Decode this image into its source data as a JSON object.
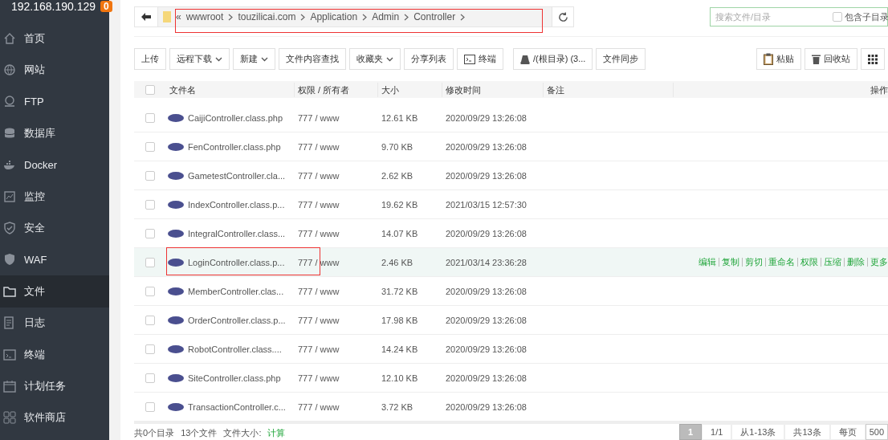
{
  "sidebar": {
    "host": "192.168.190.129",
    "badge": "0",
    "items": [
      {
        "label": "首页",
        "selected": false
      },
      {
        "label": "网站",
        "selected": false
      },
      {
        "label": "FTP",
        "selected": false
      },
      {
        "label": "数据库",
        "selected": false
      },
      {
        "label": "Docker",
        "selected": false
      },
      {
        "label": "监控",
        "selected": false
      },
      {
        "label": "安全",
        "selected": false
      },
      {
        "label": "WAF",
        "selected": false
      },
      {
        "label": "文件",
        "selected": true
      },
      {
        "label": "日志",
        "selected": false
      },
      {
        "label": "终端",
        "selected": false
      },
      {
        "label": "计划任务",
        "selected": false
      },
      {
        "label": "软件商店",
        "selected": false
      }
    ]
  },
  "path": {
    "annotated": true,
    "root_mark": "«",
    "segments": [
      "wwwroot",
      "touzilicai.com",
      "Application",
      "Admin",
      "Controller"
    ]
  },
  "search": {
    "placeholder": "搜索文件/目录",
    "include_sub": {
      "label": "包含子目录",
      "checked": false
    }
  },
  "toolbar": {
    "left": [
      {
        "label": "上传",
        "kind": "plain"
      },
      {
        "label": "远程下载",
        "kind": "dropdown"
      },
      {
        "label": "新建",
        "kind": "dropdown"
      },
      {
        "label": "文件内容查找",
        "kind": "plain"
      },
      {
        "label": "收藏夹",
        "kind": "dropdown"
      },
      {
        "label": "分享列表",
        "kind": "plain"
      },
      {
        "label": "终端",
        "kind": "terminal"
      },
      {
        "label": "/(根目录) (3...",
        "kind": "disk"
      },
      {
        "label": "文件同步",
        "kind": "plain"
      }
    ],
    "right": [
      {
        "label": "粘贴",
        "kind": "paste"
      },
      {
        "label": "回收站",
        "kind": "trash"
      },
      {
        "kind": "grid"
      }
    ]
  },
  "table": {
    "select_all": {
      "checked": false
    },
    "columns": [
      "文件名",
      "权限 / 所有者",
      "大小",
      "修改时间",
      "备注",
      "操作"
    ],
    "rows": [
      {
        "name": "CaijiController.class.php",
        "perm": "777 / www",
        "size": "12.61 KB",
        "mtime": "2020/09/29 13:26:08",
        "checked": false,
        "highlighted": false,
        "annotated": false
      },
      {
        "name": "FenController.class.php",
        "perm": "777 / www",
        "size": "9.70 KB",
        "mtime": "2020/09/29 13:26:08",
        "checked": false,
        "highlighted": false,
        "annotated": false
      },
      {
        "name": "GametestController.cla...",
        "perm": "777 / www",
        "size": "2.62 KB",
        "mtime": "2020/09/29 13:26:08",
        "checked": false,
        "highlighted": false,
        "annotated": false
      },
      {
        "name": "IndexController.class.p...",
        "perm": "777 / www",
        "size": "19.62 KB",
        "mtime": "2021/03/15 12:57:30",
        "checked": false,
        "highlighted": false,
        "annotated": false
      },
      {
        "name": "IntegralController.class...",
        "perm": "777 / www",
        "size": "14.07 KB",
        "mtime": "2020/09/29 13:26:08",
        "checked": false,
        "highlighted": false,
        "annotated": false
      },
      {
        "name": "LoginController.class.p...",
        "perm": "777 / www",
        "size": "2.46 KB",
        "mtime": "2021/03/14 23:36:28",
        "checked": false,
        "highlighted": true,
        "annotated": true,
        "actions": [
          "编辑",
          "复制",
          "剪切",
          "重命名",
          "权限",
          "压缩",
          "删除",
          "更多"
        ]
      },
      {
        "name": "MemberController.clas...",
        "perm": "777 / www",
        "size": "31.72 KB",
        "mtime": "2020/09/29 13:26:08",
        "checked": false,
        "highlighted": false,
        "annotated": false
      },
      {
        "name": "OrderController.class.p...",
        "perm": "777 / www",
        "size": "17.98 KB",
        "mtime": "2020/09/29 13:26:08",
        "checked": false,
        "highlighted": false,
        "annotated": false
      },
      {
        "name": "RobotController.class....",
        "perm": "777 / www",
        "size": "14.24 KB",
        "mtime": "2020/09/29 13:26:08",
        "checked": false,
        "highlighted": false,
        "annotated": false
      },
      {
        "name": "SiteController.class.php",
        "perm": "777 / www",
        "size": "12.10 KB",
        "mtime": "2020/09/29 13:26:08",
        "checked": false,
        "highlighted": false,
        "annotated": false
      },
      {
        "name": "TransactionController.c...",
        "perm": "777 / www",
        "size": "3.72 KB",
        "mtime": "2020/09/29 13:26:08",
        "checked": false,
        "highlighted": false,
        "annotated": false
      }
    ]
  },
  "footer": {
    "summary": [
      "共0个目录",
      "13个文件",
      "文件大小:"
    ],
    "link": "计算",
    "pager": [
      {
        "label": "1",
        "kind": "page",
        "selected": true
      },
      {
        "label": "1/1",
        "kind": "text"
      },
      {
        "label": "从1-13条",
        "kind": "text"
      },
      {
        "label": "共13条",
        "kind": "text"
      },
      {
        "label": "每页",
        "kind": "text"
      },
      {
        "label": "500",
        "kind": "select"
      }
    ]
  }
}
